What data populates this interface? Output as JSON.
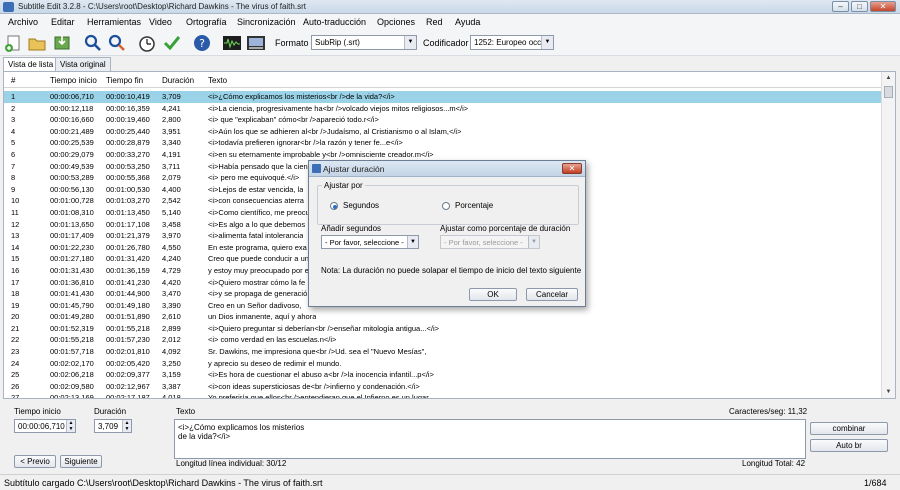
{
  "window": {
    "title": "Subtitle Edit 3.2.8 - C:\\Users\\root\\Desktop\\Richard Dawkins - The virus of faith.srt",
    "min": "–",
    "max": "□",
    "close": "✕"
  },
  "menu": [
    "Archivo",
    "Editar",
    "Herramientas",
    "Video",
    "Ortografía",
    "Sincronización",
    "Auto-traducción",
    "Opciones",
    "Red",
    "Ayuda"
  ],
  "toolbar": {
    "icons": [
      "new-file-icon",
      "open-folder-icon",
      "save-icon",
      "find-icon",
      "replace-icon",
      "fix-timing-icon",
      "check-icon",
      "help-icon",
      "waveform-icon",
      "video-icon"
    ],
    "format_label": "Formato",
    "format_value": "SubRip (.srt)",
    "encoding_label": "Codificador",
    "encoding_value": "1252: Europeo occi"
  },
  "tabs": [
    "Vista de lista",
    "Vista original"
  ],
  "grid": {
    "headers": [
      "#",
      "Tiempo inicio",
      "Tiempo fin",
      "Duración",
      "Texto"
    ],
    "rows": [
      [
        "1",
        "00:00:06,710",
        "00:00:10,419",
        "3,709",
        "<i>¿Cómo explicamos los misterios<br />de la vida?</i>"
      ],
      [
        "2",
        "00:00:12,118",
        "00:00:16,359",
        "4,241",
        "<i>La ciencia, progresivamente ha<br />volcado viejos mitos religiosos...m</i>"
      ],
      [
        "3",
        "00:00:16,660",
        "00:00:19,460",
        "2,800",
        "<i> que \"explicaban\" cómo<br />apareció todo.r</i>"
      ],
      [
        "4",
        "00:00:21,489",
        "00:00:25,440",
        "3,951",
        "<i>Aún los que se adhieren al<br />Judaísmo, al Cristianismo o al Islam,</i>"
      ],
      [
        "5",
        "00:00:25,539",
        "00:00:28,879",
        "3,340",
        "<i>todavía prefieren ignorar<br />la razón y tener fe...e</i>"
      ],
      [
        "6",
        "00:00:29,079",
        "00:00:33,270",
        "4,191",
        "<i>en su eternamente improbable y<br />omnisciente creador.m</i>"
      ],
      [
        "7",
        "00:00:49,539",
        "00:00:53,250",
        "3,711",
        "<i>Había pensado que la cien"
      ],
      [
        "8",
        "00:00:53,289",
        "00:00:55,368",
        "2,079",
        "<i> pero me equivoqué.</i>"
      ],
      [
        "9",
        "00:00:56,130",
        "00:01:00,530",
        "4,400",
        "<i>Lejos de estar vencida, la"
      ],
      [
        "10",
        "00:01:00,728",
        "00:01:03,270",
        "2,542",
        "<i>con consecuencias aterra"
      ],
      [
        "11",
        "00:01:08,310",
        "00:01:13,450",
        "5,140",
        "<i>Como científico, me preocu"
      ],
      [
        "12",
        "00:01:13,650",
        "00:01:17,108",
        "3,458",
        "<i>Es algo a lo que debemos"
      ],
      [
        "13",
        "00:01:17,409",
        "00:01:21,379",
        "3,970",
        "<i>alimenta fatal intolerancia"
      ],
      [
        "14",
        "00:01:22,230",
        "00:01:26,780",
        "4,550",
        "En este programa, quiero exa"
      ],
      [
        "15",
        "00:01:27,180",
        "00:01:31,420",
        "4,240",
        "Creo que puede conducir a un"
      ],
      [
        "16",
        "00:01:31,430",
        "00:01:36,159",
        "4,729",
        "y estoy muy preocupado por e"
      ],
      [
        "17",
        "00:01:36,810",
        "00:01:41,230",
        "4,420",
        "<i>Quiero mostrar cómo la fe"
      ],
      [
        "18",
        "00:01:41,430",
        "00:01:44,900",
        "3,470",
        "<i>y se propaga de generació"
      ],
      [
        "19",
        "00:01:45,790",
        "00:01:49,180",
        "3,390",
        "Creo en un Señor dadivoso, "
      ],
      [
        "20",
        "00:01:49,280",
        "00:01:51,890",
        "2,610",
        "un Dios inmanente, aquí y ahora"
      ],
      [
        "21",
        "00:01:52,319",
        "00:01:55,218",
        "2,899",
        "<i>Quiero preguntar si deberían<br />enseñar mitología antigua...</i>"
      ],
      [
        "22",
        "00:01:55,218",
        "00:01:57,230",
        "2,012",
        "<i> como verdad en las escuelas.n</i>"
      ],
      [
        "23",
        "00:01:57,718",
        "00:02:01,810",
        "4,092",
        "Sr. Dawkins, me impresiona que<br />Ud. sea el \"Nuevo Mesías\","
      ],
      [
        "24",
        "00:02:02,170",
        "00:02:05,420",
        "3,250",
        "y aprecio su deseo de redimir el mundo."
      ],
      [
        "25",
        "00:02:06,218",
        "00:02:09,377",
        "3,159",
        "<i>Es hora de cuestionar el abuso a<br />la inocencia infantil...p</i>"
      ],
      [
        "26",
        "00:02:09,580",
        "00:02:12,967",
        "3,387",
        "<i>con ideas supersticiosas de<br />infierno y condenación.</i>"
      ],
      [
        "27",
        "00:02:13,169",
        "00:02:17,187",
        "4,018",
        "Yo preferiría que ellos<br />entendieran que el Infierno es un lugar..."
      ]
    ]
  },
  "editor": {
    "start_label": "Tiempo inicio",
    "start_value": "00:00:06,710",
    "duration_label": "Duración",
    "duration_value": "3,709",
    "text_label": "Texto",
    "text_line1": "<i>¿Cómo explicamos los misterios",
    "text_line2": "de la vida?</i>",
    "chars_per_sec": "Caracteres/seg: 11,32",
    "prev_button": "< Previo",
    "next_button": "Siguiente",
    "line_length": "Longitud línea individual:  30/12",
    "total_length": "Longitud Total: 42",
    "combine_button": "combinar",
    "autobr_button": "Auto br"
  },
  "status": {
    "left": "Subtítulo cargado C:\\Users\\root\\Desktop\\Richard Dawkins - The virus of faith.srt",
    "right": "1/684"
  },
  "dialog": {
    "title": "Ajustar duración",
    "close": "✕",
    "group_title": "Ajustar por",
    "opt_seconds": "Segundos",
    "opt_percent": "Porcentaje",
    "selected": "Segundos",
    "add_seconds_label": "Añadir segundos",
    "add_seconds_value": "- Por favor, seleccione -",
    "percent_label": "Ajustar como porcentaje de duración",
    "percent_value": "- Por favor, seleccione -",
    "note": "Nota: La duración no puede solapar el tiempo de inicio del texto siguiente",
    "ok": "OK",
    "cancel": "Cancelar"
  },
  "colors": {
    "selected_row": "#9ad3e8",
    "accent": "#2e6fc5"
  }
}
